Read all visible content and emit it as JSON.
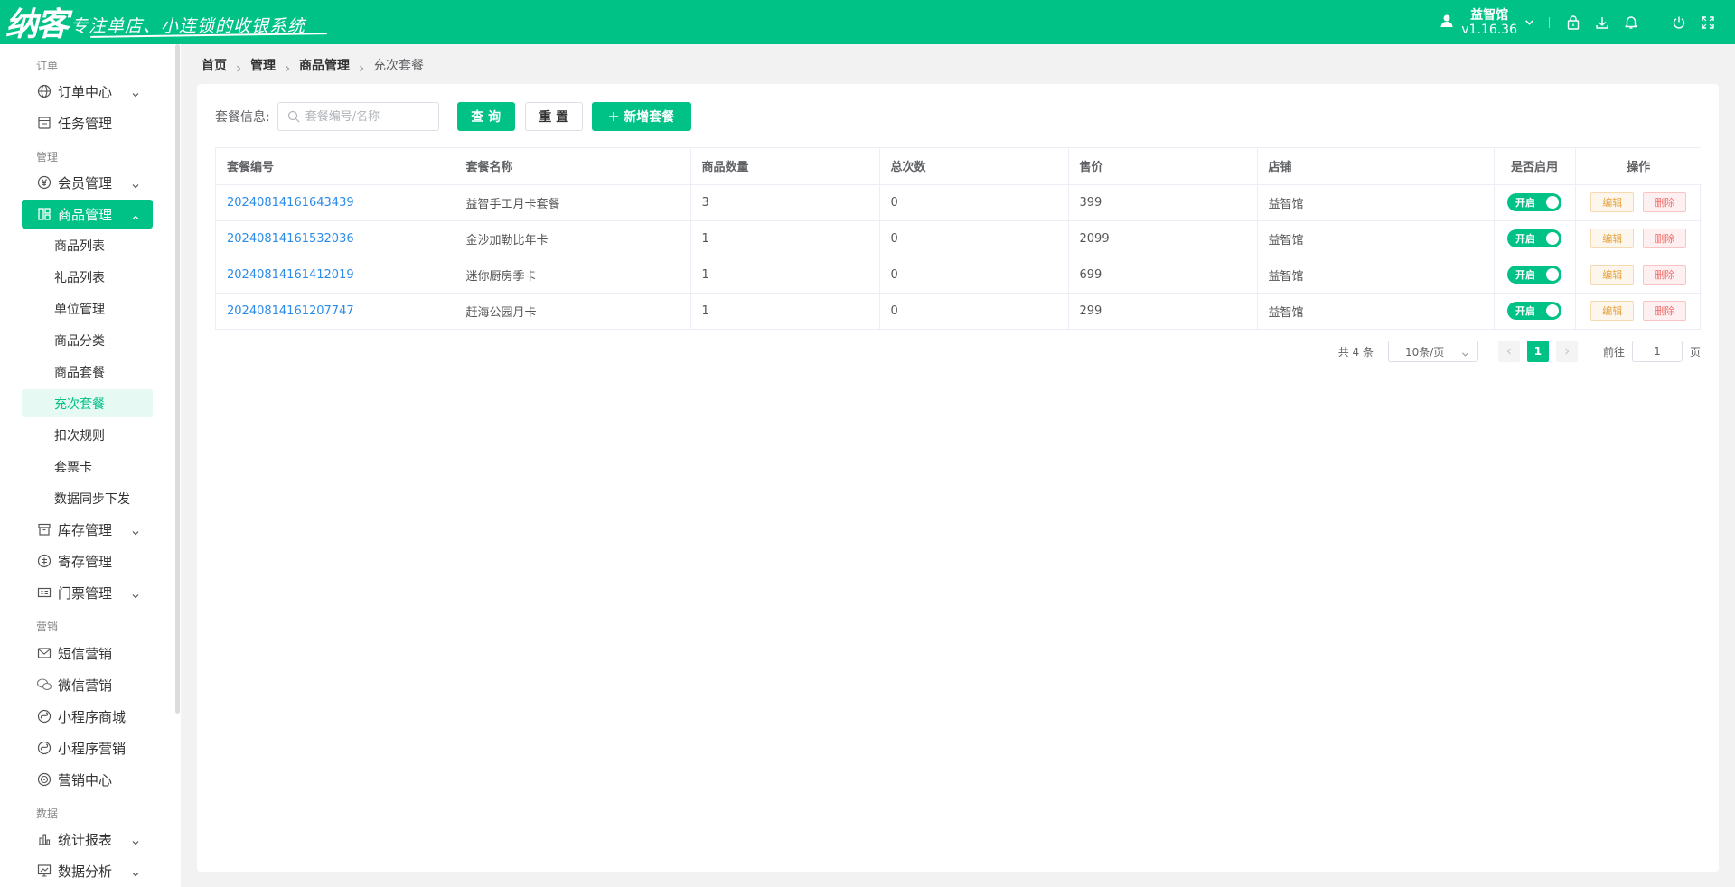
{
  "header": {
    "logo_main": "纳客",
    "logo_slogan": "专注单店、小连锁的收银系统",
    "user_name": "益智馆",
    "version": "v1.16.36",
    "icons": [
      "user-icon",
      "lock-icon",
      "download-icon",
      "bell-icon",
      "power-icon",
      "fullscreen-icon"
    ]
  },
  "sidebar": {
    "groups": {
      "order": "订单",
      "manage": "管理",
      "marketing": "营销",
      "data": "数据"
    },
    "items": {
      "order_center": "订单中心",
      "task_manage": "任务管理",
      "member_manage": "会员管理",
      "goods_manage": "商品管理",
      "goods_list": "商品列表",
      "gift_list": "礼品列表",
      "unit_manage": "单位管理",
      "goods_category": "商品分类",
      "goods_package": "商品套餐",
      "recharge_package": "充次套餐",
      "deduct_rule": "扣次规则",
      "ticket_card": "套票卡",
      "data_sync": "数据同步下发",
      "stock_manage": "库存管理",
      "deposit_manage": "寄存管理",
      "ticket_manage": "门票管理",
      "sms_marketing": "短信营销",
      "wechat_marketing": "微信营销",
      "miniapp_mall": "小程序商城",
      "miniapp_marketing": "小程序营销",
      "marketing_center": "营销中心",
      "stats_report": "统计报表",
      "data_analysis": "数据分析"
    }
  },
  "breadcrumb": [
    "首页",
    "管理",
    "商品管理",
    "充次套餐"
  ],
  "filter": {
    "label": "套餐信息:",
    "placeholder": "套餐编号/名称",
    "query": "查 询",
    "reset": "重 置",
    "add": "新增套餐"
  },
  "table": {
    "columns": [
      "套餐编号",
      "套餐名称",
      "商品数量",
      "总次数",
      "售价",
      "店铺",
      "是否启用",
      "操作"
    ],
    "rows": [
      {
        "code": "20240814161643439",
        "name": "益智手工月卡套餐",
        "qty": "3",
        "times": "0",
        "price": "399",
        "store": "益智馆",
        "enabled": "开启"
      },
      {
        "code": "20240814161532036",
        "name": "金沙加勒比年卡",
        "qty": "1",
        "times": "0",
        "price": "2099",
        "store": "益智馆",
        "enabled": "开启"
      },
      {
        "code": "20240814161412019",
        "name": "迷你厨房季卡",
        "qty": "1",
        "times": "0",
        "price": "699",
        "store": "益智馆",
        "enabled": "开启"
      },
      {
        "code": "20240814161207747",
        "name": "赶海公园月卡",
        "qty": "1",
        "times": "0",
        "price": "299",
        "store": "益智馆",
        "enabled": "开启"
      }
    ],
    "edit_label": "编辑",
    "delete_label": "删除"
  },
  "pager": {
    "total": "共 4 条",
    "page_size": "10条/页",
    "current": "1",
    "goto_label": "前往",
    "goto_value": "1",
    "page_unit": "页"
  },
  "colors": {
    "brand": "#00c287",
    "link": "#2a8be8",
    "warning": "#e6a23c",
    "danger": "#f56c6c"
  }
}
